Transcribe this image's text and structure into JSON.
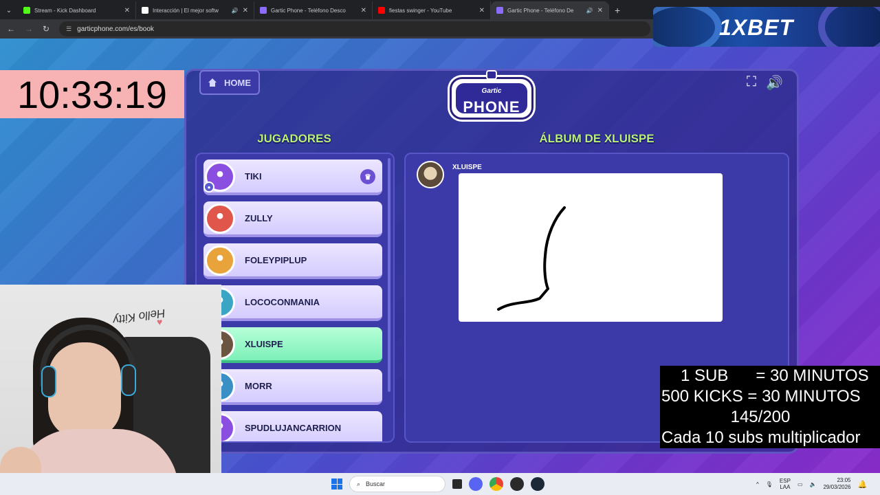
{
  "browser": {
    "tabs": [
      {
        "title": "Stream - Kick Dashboard",
        "favicon_color": "#53fc18",
        "audio": false,
        "active": false
      },
      {
        "title": "Interacción | El mejor softw",
        "favicon_color": "#ffffff",
        "audio": true,
        "active": false
      },
      {
        "title": "Gartic Phone - Teléfono Desco",
        "favicon_color": "#8b6cff",
        "audio": false,
        "active": false
      },
      {
        "title": "fiestas swinger - YouTube",
        "favicon_color": "#ff0000",
        "audio": false,
        "active": false
      },
      {
        "title": "Gartic Phone - Teléfono De",
        "favicon_color": "#8b6cff",
        "audio": true,
        "active": true
      }
    ],
    "url": "garticphone.com/es/book"
  },
  "game": {
    "home_label": "HOME",
    "logo_small": "Gartic",
    "logo_big": "PHONE",
    "players_heading": "JUGADORES",
    "album_heading": "ÁLBUM DE XLUISPE",
    "players": [
      {
        "name": "TIKI",
        "host": true,
        "active": false,
        "avatar_color": "#8a4fe0"
      },
      {
        "name": "ZULLY",
        "host": false,
        "active": false,
        "avatar_color": "#e0564a"
      },
      {
        "name": "FOLEYPIPLUP",
        "host": false,
        "active": false,
        "avatar_color": "#e8a33a"
      },
      {
        "name": "LOCOCONMANIA",
        "host": false,
        "active": false,
        "avatar_color": "#3aa6c4"
      },
      {
        "name": "XLUISPE",
        "host": false,
        "active": true,
        "avatar_color": "#6b5440"
      },
      {
        "name": "MORR",
        "host": false,
        "active": false,
        "avatar_color": "#3a8fc4"
      },
      {
        "name": "SPUDLUJANCARRION",
        "host": false,
        "active": false,
        "avatar_color": "#8a4fe0"
      }
    ],
    "album_author": "XLUISPE"
  },
  "overlay": {
    "timer": "10:33:19",
    "ad_text": "1XBET",
    "info_lines": [
      "1 SUB      = 30 MINUTOS",
      "500 KICKS = 30 MINUTOS",
      "145/200",
      "Cada 10 subs multiplicador"
    ],
    "webcam_sign": "Hello Kitty"
  },
  "taskbar": {
    "search_placeholder": "Buscar",
    "lang_top": "ESP",
    "lang_bottom": "LAA",
    "time": "23:05",
    "date": "29/03/2026"
  }
}
